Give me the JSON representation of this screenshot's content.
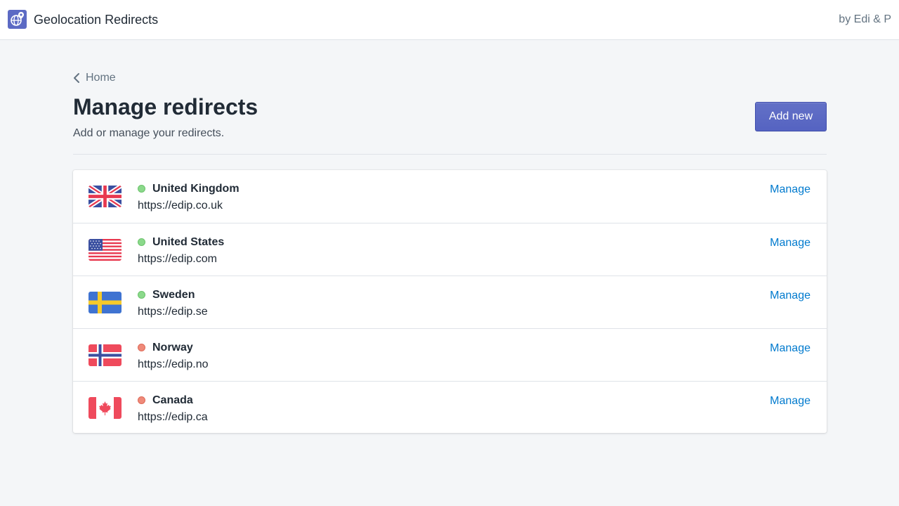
{
  "header": {
    "app_title": "Geolocation Redirects",
    "byline": "by Edi & P",
    "logo_icon": "globe-pin-icon",
    "brand_color": "#5c6ac4"
  },
  "breadcrumb": {
    "label": "Home",
    "icon": "chevron-left-icon"
  },
  "page": {
    "title": "Manage redirects",
    "subtitle": "Add or manage your redirects."
  },
  "actions": {
    "add_new_label": "Add new"
  },
  "redirects": [
    {
      "country": "United Kingdom",
      "url": "https://edip.co.uk",
      "status": "active",
      "status_color": "#8bd98b",
      "flag": "uk-flag-icon",
      "action_label": "Manage"
    },
    {
      "country": "United States",
      "url": "https://edip.com",
      "status": "active",
      "status_color": "#8bd98b",
      "flag": "us-flag-icon",
      "action_label": "Manage"
    },
    {
      "country": "Sweden",
      "url": "https://edip.se",
      "status": "active",
      "status_color": "#8bd98b",
      "flag": "sweden-flag-icon",
      "action_label": "Manage"
    },
    {
      "country": "Norway",
      "url": "https://edip.no",
      "status": "inactive",
      "status_color": "#ef8a7a",
      "flag": "norway-flag-icon",
      "action_label": "Manage"
    },
    {
      "country": "Canada",
      "url": "https://edip.ca",
      "status": "inactive",
      "status_color": "#ef8a7a",
      "flag": "canada-flag-icon",
      "action_label": "Manage"
    }
  ]
}
